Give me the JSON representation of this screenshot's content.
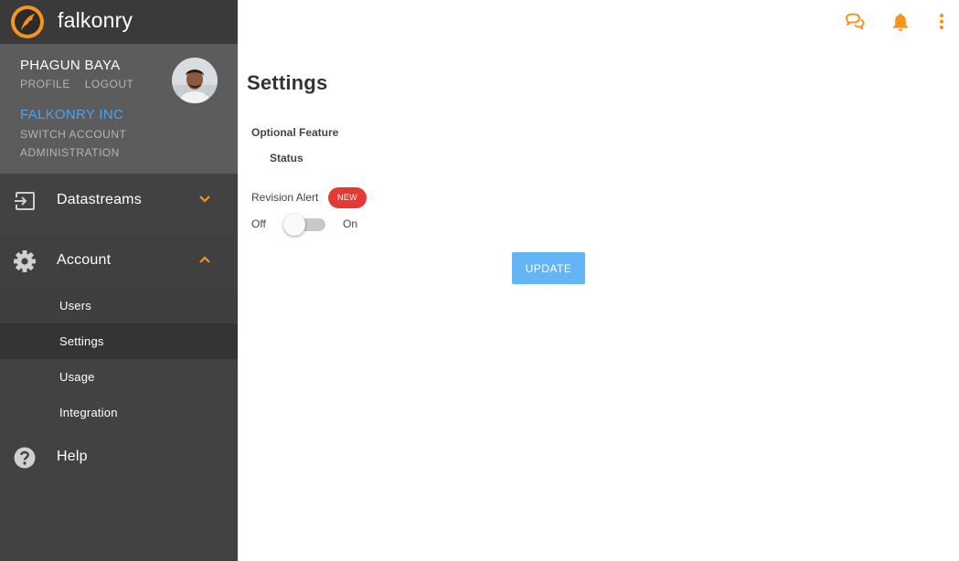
{
  "app": {
    "name": "falkonry"
  },
  "user": {
    "name": "PHAGUN BAYA",
    "profile_label": "PROFILE",
    "logout_label": "LOGOUT"
  },
  "org": {
    "name": "FALKONRY INC",
    "switch_label": "SWITCH ACCOUNT",
    "admin_label": "ADMINISTRATION"
  },
  "nav": {
    "datastreams": "Datastreams",
    "account": "Account",
    "account_items": [
      "Users",
      "Settings",
      "Usage",
      "Integration"
    ],
    "help": "Help",
    "selected": "Settings"
  },
  "topbar_icons": [
    "chat-icon",
    "bell-icon",
    "more-vert-icon"
  ],
  "settings": {
    "title": "Settings",
    "section_title": "Optional Feature",
    "status_header": "Status",
    "feature_name": "Revision Alert",
    "badge": "NEW",
    "toggle_off": "Off",
    "toggle_on": "On",
    "toggle_state": false,
    "update_label": "UPDATE"
  },
  "colors": {
    "accent": "#f7941d",
    "sidebar": "#424242",
    "org_link": "#4aa3f0",
    "badge": "#e53935",
    "button": "#64b5f6"
  }
}
